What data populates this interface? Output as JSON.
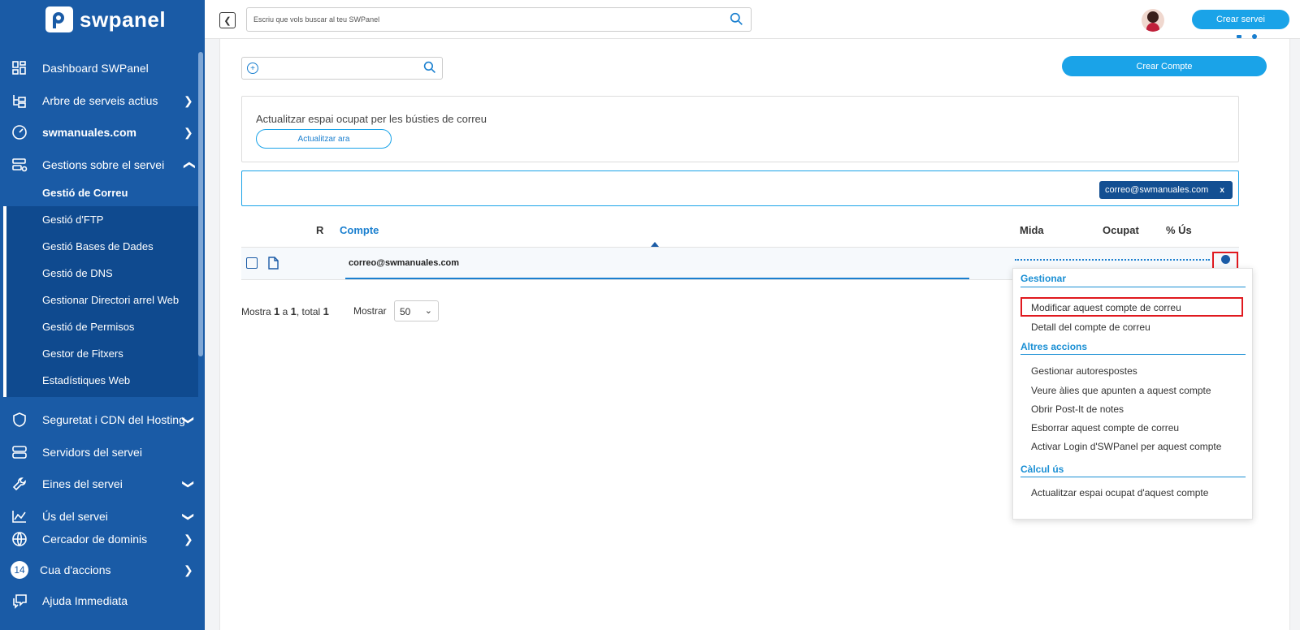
{
  "brand": {
    "name": "swpanel"
  },
  "sidebar": {
    "items": [
      {
        "label": "Dashboard SWPanel",
        "icon": "dashboard-icon"
      },
      {
        "label": "Arbre de serveis actius",
        "icon": "tree-icon"
      },
      {
        "label": "swmanuales.com",
        "icon": "gauge-icon"
      },
      {
        "label": "Gestions sobre el servei",
        "icon": "server-gear-icon"
      },
      {
        "label": "Seguretat i CDN del Hosting",
        "icon": "shield-icon"
      },
      {
        "label": "Servidors del servei",
        "icon": "servers-icon"
      },
      {
        "label": "Eines del servei",
        "icon": "wrench-icon"
      },
      {
        "label": "Ús del servei",
        "icon": "chart-icon"
      },
      {
        "label": "Cercador de dominis",
        "icon": "globe-icon"
      },
      {
        "label": "Cua d'accions",
        "badge": "14"
      },
      {
        "label": "Ajuda Immediata",
        "icon": "chat-icon"
      }
    ],
    "subitems": [
      {
        "label": "Gestió de Correu"
      },
      {
        "label": "Gestió d'FTP"
      },
      {
        "label": "Gestió Bases de Dades"
      },
      {
        "label": "Gestió de DNS"
      },
      {
        "label": "Gestionar Directori arrel Web"
      },
      {
        "label": "Gestió de Permisos"
      },
      {
        "label": "Gestor de Fitxers"
      },
      {
        "label": "Estadístiques Web"
      }
    ]
  },
  "topbar": {
    "search_placeholder": "Escriu que vols buscar al teu SWPanel",
    "create_service": "Crear servei"
  },
  "main": {
    "create_account": "Crear Compte",
    "update_text": "Actualitzar espai ocupat per les bústies de correu",
    "update_button": "Actualitzar ara",
    "filter_tag": "correo@swmanuales.com",
    "filter_tag_close": "x",
    "table": {
      "headers": {
        "r": "R",
        "compte": "Compte",
        "mida": "Mida",
        "ocupat": "Ocupat",
        "us": "% Ús"
      },
      "rows": [
        {
          "compte": "correo@swmanuales.com"
        }
      ]
    },
    "pagination": {
      "prefix": "Mostra",
      "from": "1",
      "a": "a",
      "to": "1",
      "total_label": ", total",
      "total": "1"
    },
    "show_label": "Mostrar",
    "show_value": "50"
  },
  "menu": {
    "sections": [
      {
        "title": "Gestionar",
        "items": [
          "Modificar aquest compte de correu",
          "Detall del compte de correu"
        ]
      },
      {
        "title": "Altres accions",
        "items": [
          "Gestionar autorespostes",
          "Veure àlies que apunten a aquest compte",
          "Obrir Post-It de notes",
          "Esborrar aquest compte de correu",
          "Activar Login d'SWPanel per aquest compte"
        ]
      },
      {
        "title": "Càlcul ús",
        "items": [
          "Actualitzar espai ocupat d'aquest compte"
        ]
      }
    ]
  },
  "colors": {
    "sidebar": "#1a5ba6",
    "accent": "#1aa3e8",
    "highlight": "#e0191f"
  }
}
